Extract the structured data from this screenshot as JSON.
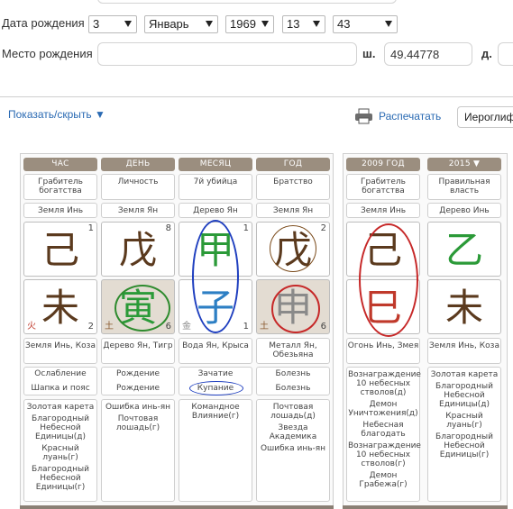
{
  "form": {
    "dob_label": "Дата рождения",
    "day": "3",
    "month": "Январь",
    "year": "1969",
    "hour": "13",
    "minute": "43",
    "pob_label": "Место рождения",
    "pob_value": "",
    "lat_label": "ш.",
    "lat_value": "49.44778",
    "lon_label": "д."
  },
  "toolbar": {
    "toggle_label": "Показать/скрыть ▼",
    "print_label": "Распечатать",
    "hiero_label": "Иероглиф"
  },
  "pillars": {
    "headers": [
      "ЧАС",
      "ДЕНЬ",
      "МЕСЯЦ",
      "ГОД"
    ],
    "stars": [
      "Грабитель богатства",
      "Личность",
      "7й убийца",
      "Братство"
    ],
    "stem_elements": [
      "Земля Инь",
      "Земля Ян",
      "Дерево Ян",
      "Земля Ян"
    ],
    "stems": [
      {
        "glyph": "己",
        "num": "1",
        "color": "#5b3a1e"
      },
      {
        "glyph": "戊",
        "num": "8",
        "color": "#5b3a1e"
      },
      {
        "glyph": "甲",
        "num": "1",
        "color": "#2b9a38"
      },
      {
        "glyph": "戊",
        "num": "2",
        "color": "#5b3a1e"
      }
    ],
    "branches": [
      {
        "glyph": "未",
        "num": "2",
        "color": "#5b3a1e",
        "el": "火",
        "el_color": "#c0392b"
      },
      {
        "glyph": "寅",
        "num": "6",
        "color": "#2b9a38",
        "el": "土",
        "el_color": "#8a5a2e"
      },
      {
        "glyph": "子",
        "num": "1",
        "color": "#2d7fc4",
        "el": "金",
        "el_color": "#888888"
      },
      {
        "glyph": "申",
        "num": "6",
        "color": "#8a8a8a",
        "el": "土",
        "el_color": "#8a5a2e"
      }
    ],
    "branch_desc": [
      "Земля Инь, Коза",
      "Дерево Ян, Тигр",
      "Вода Ян, Крыса",
      "Металл Ян, Обезьяна"
    ],
    "stage1": [
      "Ослабление",
      "Рождение",
      "Зачатие",
      "Болезнь"
    ],
    "stage2": [
      "Шапка и пояс",
      "Рождение",
      "Купание",
      "Болезнь"
    ],
    "symbols": [
      [
        "Золотая карета",
        "Благородный Небесной Единицы(д)",
        "Красный луань(г)",
        "Благородный Небесной Единицы(г)"
      ],
      [
        "Ошибка инь-ян",
        "Почтовая лошадь(г)"
      ],
      [
        "Командное Влияние(г)"
      ],
      [
        "Почтовая лошадь(д)",
        "Звезда Академика",
        "Ошибка инь-ян"
      ]
    ]
  },
  "luck": {
    "headers": [
      "2009 ГОД",
      "2015 ▼"
    ],
    "stars": [
      "Грабитель богатства",
      "Правильная власть"
    ],
    "stem_elements": [
      "Земля Инь",
      "Дерево Инь"
    ],
    "stems": [
      {
        "glyph": "己",
        "color": "#5b3a1e"
      },
      {
        "glyph": "乙",
        "color": "#2b9a38"
      }
    ],
    "branches": [
      {
        "glyph": "巳",
        "color": "#c0392b"
      },
      {
        "glyph": "未",
        "color": "#5b3a1e"
      }
    ],
    "branch_desc": [
      "Огонь Инь, Змея",
      "Земля Инь, Коза"
    ],
    "symbols": [
      [
        "Вознаграждение 10 небесных стволов(д)",
        "Демон Уничтожения(д)",
        "Небесная благодать",
        "Вознаграждение 10 небесных стволов(г)",
        "Демон Грабежа(г)"
      ],
      [
        "Золотая карета",
        "Благородный Небесной Единицы(д)",
        "Красный луань(г)",
        "Благородный Небесной Единицы(г)"
      ]
    ]
  },
  "colors": {
    "header_bg": "#9b8e7f",
    "link": "#2a6ab3",
    "ring_blue": "#1f3fbf",
    "ring_red": "#c62828",
    "ring_green": "#2e8b2e",
    "ring_brown": "#7a4a1a"
  },
  "icons": [
    "printer-icon",
    "dropdown-arrow-icon"
  ]
}
